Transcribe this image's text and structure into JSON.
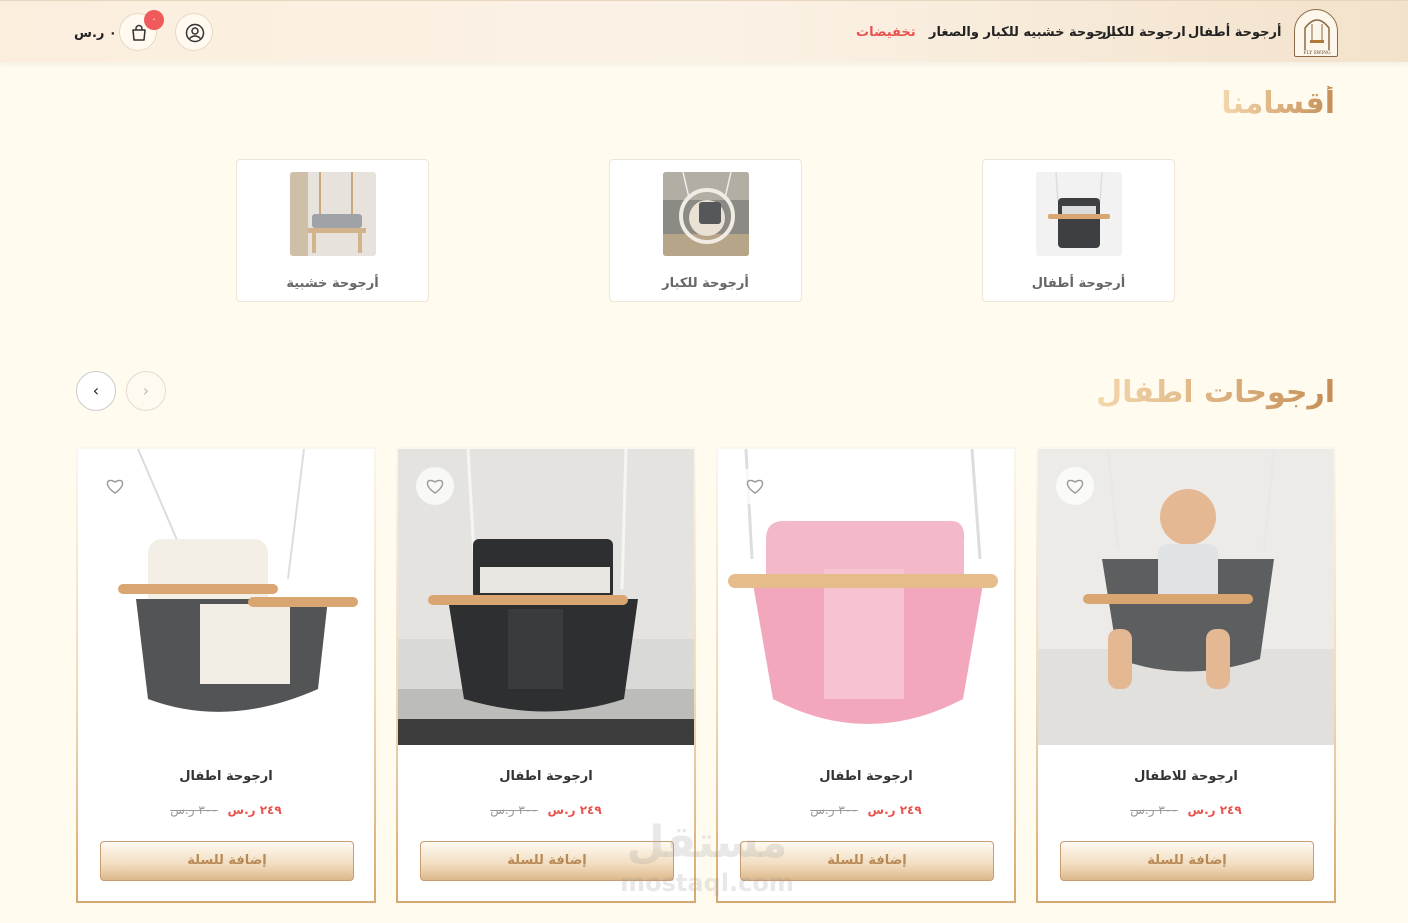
{
  "header": {
    "logo_text": "FLY SWING",
    "nav": [
      "أرجوحة أطفال",
      "ارجوحة للكبار",
      "ارجوحة خشبيه للكبار والصغار",
      "تخفيضات"
    ],
    "cart_count": "٠",
    "cart_total": "٠ ر.س",
    "icons": {
      "account": "user-circle-icon",
      "cart": "shopping-bag-icon"
    }
  },
  "categories": {
    "title": "أقسامنا",
    "items": [
      {
        "label": "أرجوحة خشبية"
      },
      {
        "label": "أرجوحة للكبار"
      },
      {
        "label": "أرجوحة أطفال"
      }
    ]
  },
  "products": {
    "title": "ارجوحات اطفال",
    "prev_arrow": "›",
    "next_arrow": "‹",
    "items": [
      {
        "name": "ارجوحة اطفال",
        "price": "٢٤٩ ر.س",
        "old_price": "٣٠٠ ر.س",
        "button": "إضافة للسلة"
      },
      {
        "name": "ارجوحة اطفال",
        "price": "٢٤٩ ر.س",
        "old_price": "٣٠٠ ر.س",
        "button": "إضافة للسلة"
      },
      {
        "name": "ارجوحة اطفال",
        "price": "٢٤٩ ر.س",
        "old_price": "٣٠٠ ر.س",
        "button": "إضافة للسلة"
      },
      {
        "name": "ارجوحة للاطفال",
        "price": "٢٤٩ ر.س",
        "old_price": "٣٠٠ ر.س",
        "button": "إضافة للسلة"
      }
    ]
  },
  "watermark": {
    "arabic": "مستقل",
    "latin": "mostaql.com"
  },
  "colors": {
    "accent": "#e8534f",
    "gold": "#c48e55",
    "background": "#fffbef"
  }
}
